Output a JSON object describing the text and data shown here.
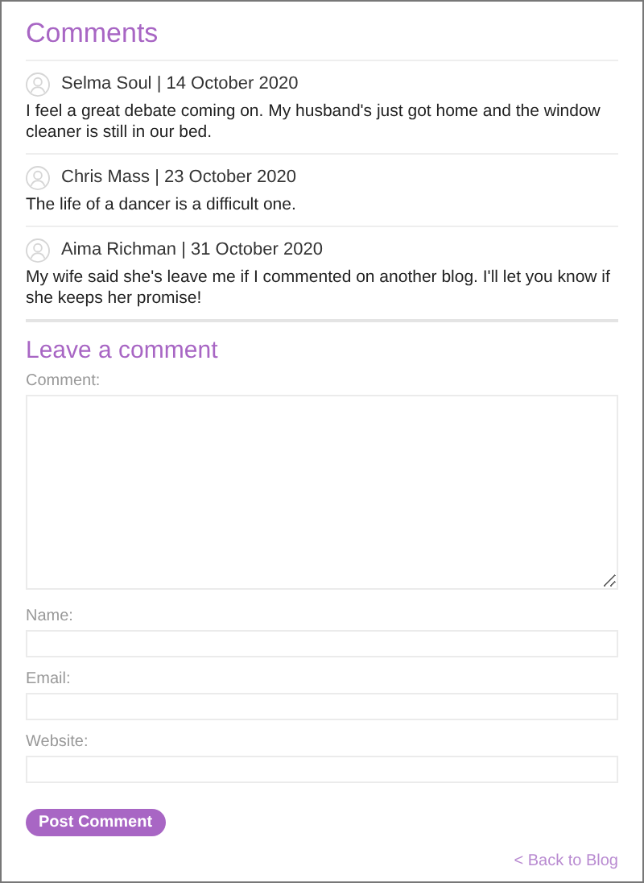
{
  "comments_title": "Comments",
  "comments": [
    {
      "author": "Selma Soul",
      "separator": "|",
      "date": "14 October 2020",
      "text": "I feel a great debate coming on. My husband's just got home and the window cleaner is still in our bed."
    },
    {
      "author": "Chris Mass",
      "separator": "|",
      "date": "23 October 2020",
      "text": "The life of a dancer is a difficult one."
    },
    {
      "author": "Aima Richman",
      "separator": "|",
      "date": "31 October 2020",
      "text": "My wife said she's leave me if I commented on another blog. I'll let you know if she keeps her promise!"
    }
  ],
  "form": {
    "title": "Leave a comment",
    "fields": [
      {
        "label": "Comment:",
        "kind": "textarea"
      },
      {
        "label": "Name:",
        "kind": "input"
      },
      {
        "label": "Email:",
        "kind": "input"
      },
      {
        "label": "Website:",
        "kind": "input"
      }
    ],
    "submit": "Post Comment"
  },
  "back_link": "< Back to Blog"
}
